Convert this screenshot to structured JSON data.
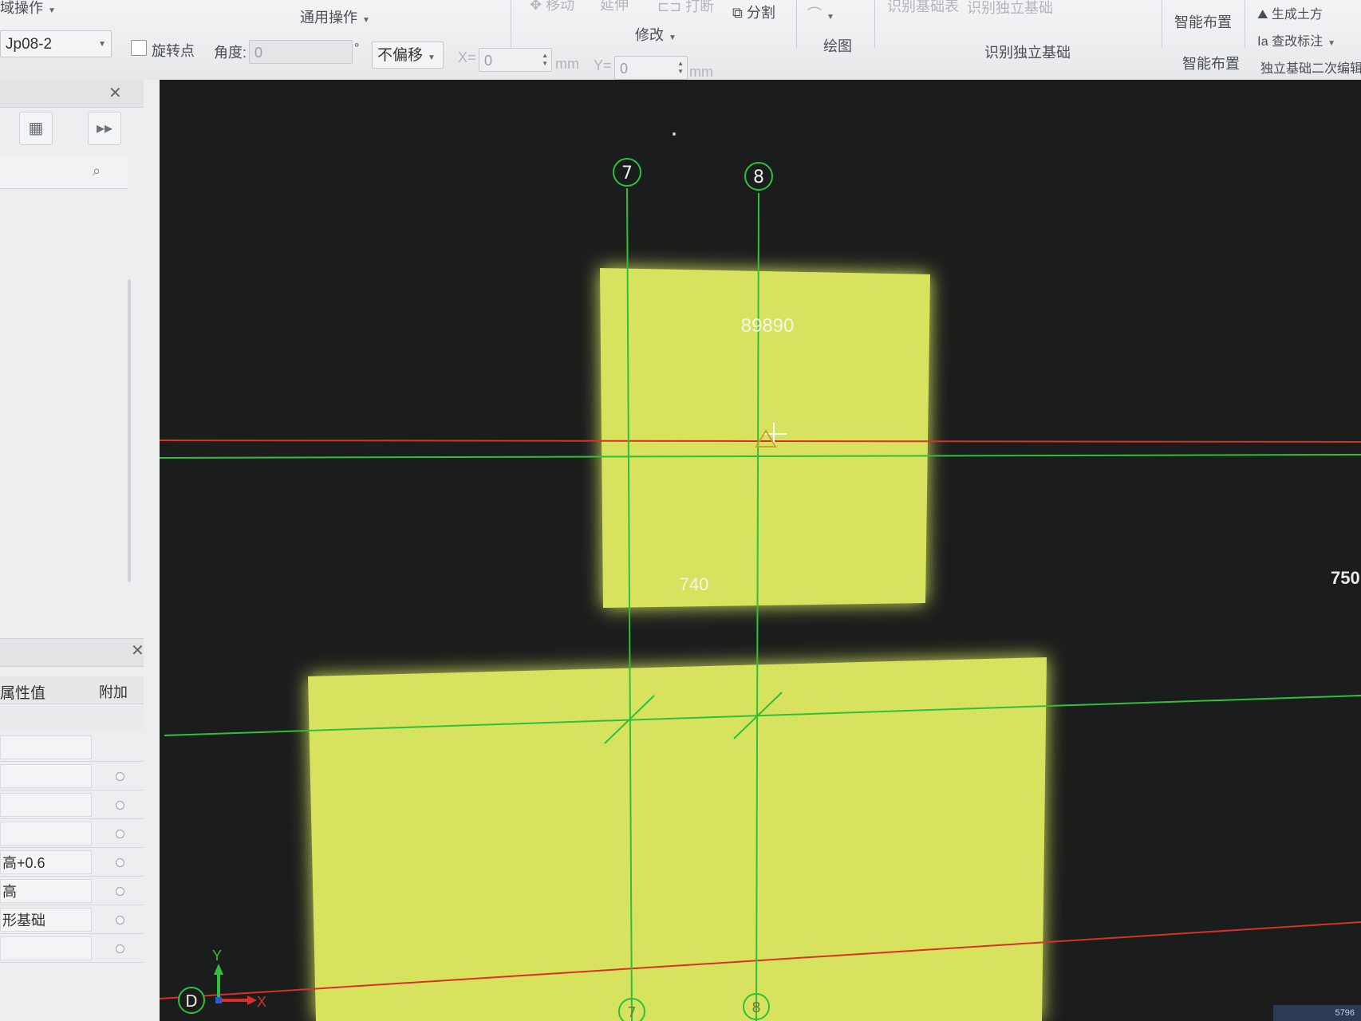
{
  "toolbar": {
    "group_prev_title": "域操作",
    "general_ops_label": "通用操作",
    "move_label": "移动",
    "stretch_label": "延伸",
    "break_label": "打断",
    "split_label": "分割",
    "modify_label": "修改",
    "draw_label": "绘图",
    "identify_table_label": "识别基础表",
    "identify_isolated_top_label": "识别独立基础",
    "identify_isolated_group_label": "识别独立基础",
    "smart_layout_button_label": "智能布置",
    "smart_layout_group_label": "智能布置",
    "generate_earthwork_label": "生成土方",
    "check_annotation_label": "查改标注",
    "isolated_secondary_edit_label": "独立基础二次编辑",
    "component_combo_value": "Jp08-2",
    "rotate_point_label": "旋转点",
    "angle_label": "角度:",
    "angle_value": "0",
    "degree_symbol": "°",
    "offset_combo_value": "不偏移",
    "x_label": "X=",
    "x_value": "0",
    "y_label": "Y=",
    "y_value": "0",
    "unit_mm": "mm"
  },
  "left_panel": {
    "properties_header_value": "属性值",
    "properties_header_extra": "附加",
    "rows": [
      {
        "value": ""
      },
      {
        "value": ""
      },
      {
        "value": ""
      },
      {
        "value": ""
      },
      {
        "value": "高+0.6"
      },
      {
        "value": "高"
      },
      {
        "value": "形基础"
      },
      {
        "value": ""
      }
    ],
    "collapse_arrow": "‹"
  },
  "canvas": {
    "grid_axis_top_7": "7",
    "grid_axis_top_8": "8",
    "grid_axis_bottom_7": "7",
    "grid_axis_bottom_8": "8",
    "grid_axis_left_D": "D",
    "foundation_top_label": "89890",
    "foundation_top_dim": "740",
    "right_dim_label": "750",
    "ucs_y": "Y",
    "ucs_x": "X",
    "colors": {
      "background": "#1b1d1c",
      "foundation_fill": "#d7e35e",
      "grid_line": "#2fbf3a",
      "red_line": "#d8302c"
    }
  },
  "status": {
    "text": "5796"
  }
}
